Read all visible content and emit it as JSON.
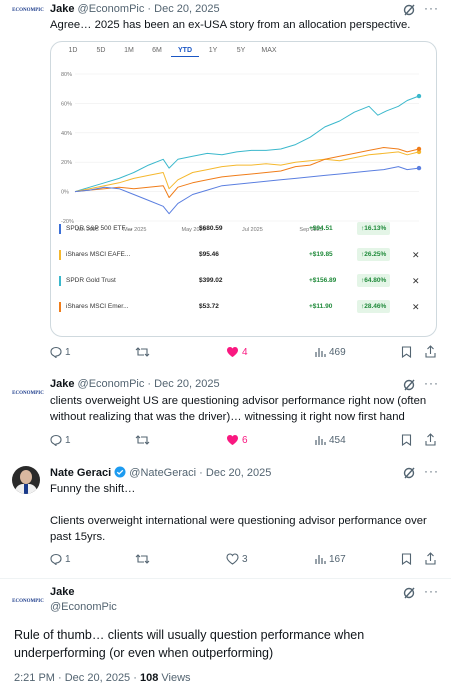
{
  "tweets": [
    {
      "author": "Jake",
      "handle": "@EconomPic",
      "date": "Dec 20, 2025",
      "avatar_text": "ECONOMPIC",
      "text": "Agree… 2025 has been an ex-USA story from an allocation perspective.",
      "stats": {
        "replies": "1",
        "reposts": "",
        "likes": "4",
        "views": "469"
      },
      "liked": true
    },
    {
      "author": "Jake",
      "handle": "@EconomPic",
      "date": "Dec 20, 2025",
      "avatar_text": "ECONOMPIC",
      "text": "clients overweight US are questioning advisor performance right now (often without realizing that was the driver)… witnessing it right now first hand",
      "stats": {
        "replies": "1",
        "reposts": "",
        "likes": "6",
        "views": "454"
      },
      "liked": true
    },
    {
      "author": "Nate Geraci",
      "handle": "@NateGeraci",
      "date": "Dec 20, 2025",
      "verified": true,
      "text_line1": "Funny the shift…",
      "text_line2": "Clients overweight international were questioning advisor performance over past 15yrs.",
      "stats": {
        "replies": "1",
        "reposts": "",
        "likes": "3",
        "views": "167"
      },
      "liked": false
    }
  ],
  "main_tweet": {
    "author": "Jake",
    "handle": "@EconomPic",
    "avatar_text": "ECONOMPIC",
    "text": "Rule of thumb… clients will usually question performance when underperforming (or even when outperforming)",
    "time": "2:21 PM · Dec 20, 2025 · ",
    "views_count": "108",
    "views_label": "Views"
  },
  "chart_tabs": [
    "1D",
    "5D",
    "1M",
    "6M",
    "YTD",
    "1Y",
    "5Y",
    "MAX"
  ],
  "chart_active_tab": "YTD",
  "chart_data": {
    "type": "line",
    "x_ticks": [
      "Jan 2025",
      "Mar 2025",
      "May 2025",
      "Jul 2025",
      "Sep 2025",
      "Nov 2025"
    ],
    "y_ticks": [
      "80%",
      "60%",
      "40%",
      "20%",
      "0%",
      "-20%"
    ],
    "ylim": [
      -20,
      80
    ],
    "x_range": [
      0,
      11.7
    ],
    "series": [
      {
        "name": "SPDR Gold Trust",
        "color": "#3bb8cc",
        "x": [
          0,
          0.5,
          1,
          1.5,
          2,
          2.5,
          3,
          3.2,
          3.5,
          4,
          4.5,
          5,
          5.5,
          6,
          6.5,
          7,
          7.5,
          8,
          8.5,
          9,
          9.5,
          10,
          10.3,
          10.6,
          11,
          11.3,
          11.7
        ],
        "y": [
          0,
          3,
          6,
          9,
          13,
          18,
          22,
          16,
          22,
          24,
          26,
          25,
          27,
          28,
          28,
          29,
          32,
          37,
          44,
          48,
          54,
          58,
          52,
          55,
          58,
          62,
          65
        ]
      },
      {
        "name": "iShares MSCI EAFE...",
        "color": "#f5b82e",
        "x": [
          0,
          0.5,
          1,
          1.5,
          2,
          2.5,
          3,
          3.2,
          3.5,
          4,
          4.5,
          5,
          5.5,
          6,
          6.5,
          7,
          7.5,
          8,
          8.5,
          9,
          9.5,
          10,
          10.5,
          11,
          11.3,
          11.7
        ],
        "y": [
          0,
          2,
          4,
          6,
          9,
          11,
          13,
          2,
          8,
          13,
          15,
          17,
          18,
          18,
          19,
          18,
          20,
          21,
          22,
          21,
          23,
          25,
          26,
          27,
          25,
          27
        ]
      },
      {
        "name": "iShares MSCI Emer...",
        "color": "#f07d1a",
        "x": [
          0,
          0.5,
          1,
          1.5,
          2,
          2.5,
          3,
          3.2,
          3.5,
          4,
          4.5,
          5,
          5.5,
          6,
          6.5,
          7,
          7.5,
          8,
          8.5,
          9,
          9.5,
          10,
          10.5,
          11,
          11.3,
          11.7
        ],
        "y": [
          0,
          1,
          2,
          3,
          2,
          3,
          4,
          -4,
          3,
          6,
          8,
          10,
          11,
          12,
          13,
          14,
          17,
          18,
          22,
          24,
          26,
          28,
          30,
          29,
          27,
          29
        ]
      },
      {
        "name": "SPDR S&P 500 ETF ...",
        "color": "#5b7fe0",
        "x": [
          0,
          0.5,
          1,
          1.5,
          2,
          2.5,
          3,
          3.2,
          3.5,
          4,
          4.5,
          5,
          5.5,
          6,
          6.5,
          7,
          7.5,
          8,
          8.5,
          9,
          9.5,
          10,
          10.5,
          11,
          11.3,
          11.7
        ],
        "y": [
          0,
          1,
          3,
          2,
          -2,
          -6,
          -10,
          -15,
          -8,
          -2,
          1,
          4,
          5,
          6,
          7,
          8,
          9,
          10,
          11,
          12,
          13,
          14,
          15,
          17,
          15,
          16
        ]
      }
    ]
  },
  "holdings": [
    {
      "name": "SPDR S&P 500 ETF ...",
      "price": "$680.59",
      "change": "+$94.51",
      "pct": "↑16.13%",
      "color": "#3b6fd6",
      "removable": false
    },
    {
      "name": "iShares MSCI EAFE...",
      "price": "$95.46",
      "change": "+$19.85",
      "pct": "↑26.25%",
      "color": "#f5b82e",
      "removable": true
    },
    {
      "name": "SPDR Gold Trust",
      "price": "$399.02",
      "change": "+$156.89",
      "pct": "↑64.80%",
      "color": "#3bb8cc",
      "removable": true
    },
    {
      "name": "iShares MSCI Emer...",
      "price": "$53.72",
      "change": "+$11.90",
      "pct": "↑28.46%",
      "color": "#f07d1a",
      "removable": true
    }
  ],
  "remove_glyph": "✕",
  "sep": "·"
}
